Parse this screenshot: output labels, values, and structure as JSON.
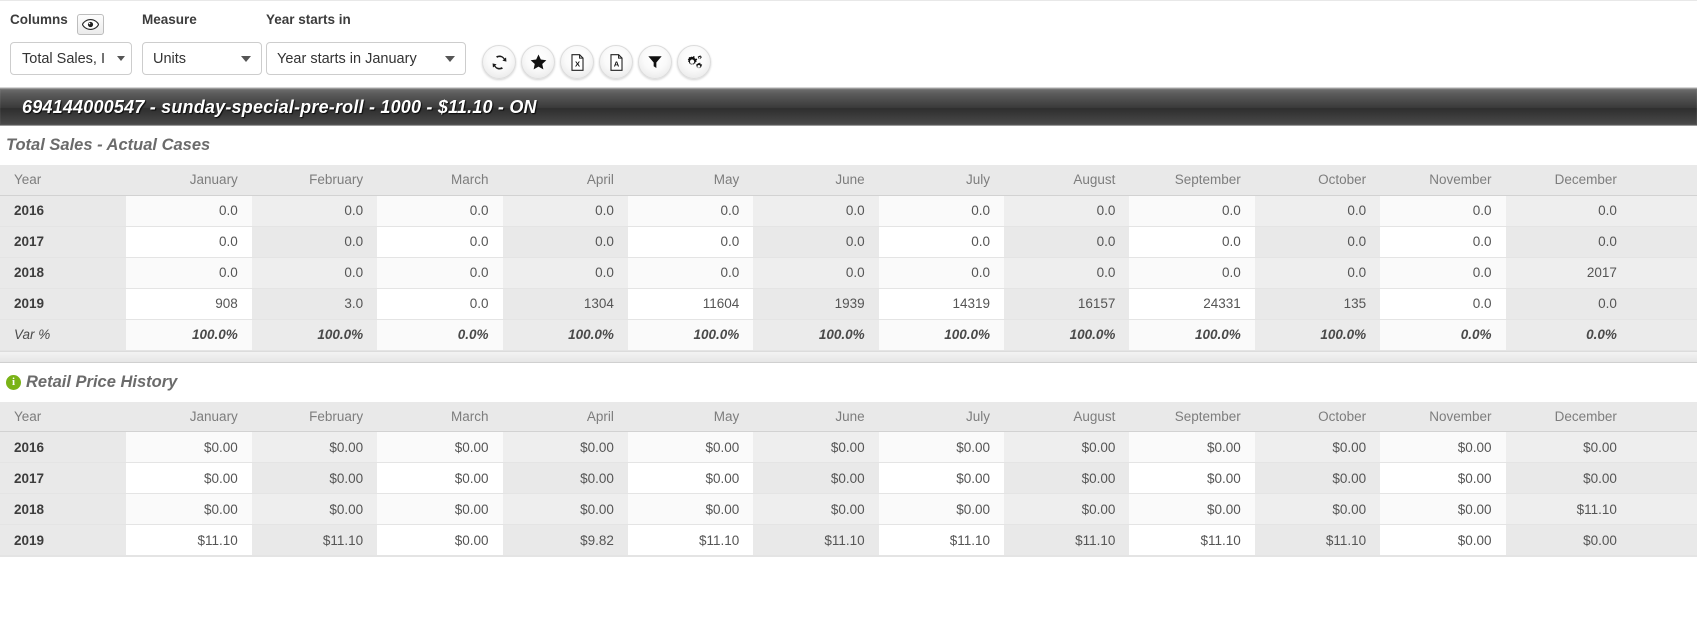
{
  "toolbar": {
    "columns": {
      "label": "Columns",
      "eye_icon": "eye-icon",
      "value": "Total Sales, I"
    },
    "measure": {
      "label": "Measure",
      "value": "Units"
    },
    "year_starts_in": {
      "label": "Year starts in",
      "value": "Year starts in January"
    },
    "buttons": [
      {
        "name": "refresh-button",
        "icon": "refresh-icon"
      },
      {
        "name": "favorite-button",
        "icon": "star-icon"
      },
      {
        "name": "export-excel-button",
        "icon": "excel-file-icon"
      },
      {
        "name": "export-pdf-button",
        "icon": "pdf-file-icon"
      },
      {
        "name": "filter-button",
        "icon": "funnel-icon"
      },
      {
        "name": "settings-button",
        "icon": "gears-icon"
      }
    ]
  },
  "header": {
    "title": "694144000547 - sunday-special-pre-roll - 1000 - $11.10 - ON"
  },
  "sections": [
    {
      "title": "Total Sales - Actual Cases",
      "has_info_icon": false,
      "columns": [
        "Year",
        "January",
        "February",
        "March",
        "April",
        "May",
        "June",
        "July",
        "August",
        "September",
        "October",
        "November",
        "December"
      ],
      "rows": [
        {
          "type": "data",
          "cells": [
            "2016",
            "0.0",
            "0.0",
            "0.0",
            "0.0",
            "0.0",
            "0.0",
            "0.0",
            "0.0",
            "0.0",
            "0.0",
            "0.0",
            "0.0"
          ]
        },
        {
          "type": "data",
          "cells": [
            "2017",
            "0.0",
            "0.0",
            "0.0",
            "0.0",
            "0.0",
            "0.0",
            "0.0",
            "0.0",
            "0.0",
            "0.0",
            "0.0",
            "0.0"
          ]
        },
        {
          "type": "data",
          "cells": [
            "2018",
            "0.0",
            "0.0",
            "0.0",
            "0.0",
            "0.0",
            "0.0",
            "0.0",
            "0.0",
            "0.0",
            "0.0",
            "0.0",
            "2017"
          ]
        },
        {
          "type": "data",
          "cells": [
            "2019",
            "908",
            "3.0",
            "0.0",
            "1304",
            "11604",
            "1939",
            "14319",
            "16157",
            "24331",
            "135",
            "0.0",
            "0.0"
          ]
        },
        {
          "type": "var",
          "cells": [
            "Var %",
            "100.0%",
            "100.0%",
            "0.0%",
            "100.0%",
            "100.0%",
            "100.0%",
            "100.0%",
            "100.0%",
            "100.0%",
            "100.0%",
            "0.0%",
            "0.0%"
          ]
        }
      ]
    },
    {
      "title": "Retail Price History",
      "has_info_icon": true,
      "info_icon": "info-icon",
      "columns": [
        "Year",
        "January",
        "February",
        "March",
        "April",
        "May",
        "June",
        "July",
        "August",
        "September",
        "October",
        "November",
        "December"
      ],
      "rows": [
        {
          "type": "data",
          "cells": [
            "2016",
            "$0.00",
            "$0.00",
            "$0.00",
            "$0.00",
            "$0.00",
            "$0.00",
            "$0.00",
            "$0.00",
            "$0.00",
            "$0.00",
            "$0.00",
            "$0.00"
          ]
        },
        {
          "type": "data",
          "cells": [
            "2017",
            "$0.00",
            "$0.00",
            "$0.00",
            "$0.00",
            "$0.00",
            "$0.00",
            "$0.00",
            "$0.00",
            "$0.00",
            "$0.00",
            "$0.00",
            "$0.00"
          ]
        },
        {
          "type": "data",
          "cells": [
            "2018",
            "$0.00",
            "$0.00",
            "$0.00",
            "$0.00",
            "$0.00",
            "$0.00",
            "$0.00",
            "$0.00",
            "$0.00",
            "$0.00",
            "$0.00",
            "$11.10"
          ]
        },
        {
          "type": "data",
          "cells": [
            "2019",
            "$11.10",
            "$11.10",
            "$0.00",
            "$9.82",
            "$11.10",
            "$11.10",
            "$11.10",
            "$11.10",
            "$11.10",
            "$11.10",
            "$0.00",
            "$0.00"
          ]
        }
      ]
    }
  ],
  "colors": {
    "header_bar_dark": "#3a3a3a",
    "table_header_bg": "#e9e9e9",
    "info_green": "#7ab317"
  }
}
